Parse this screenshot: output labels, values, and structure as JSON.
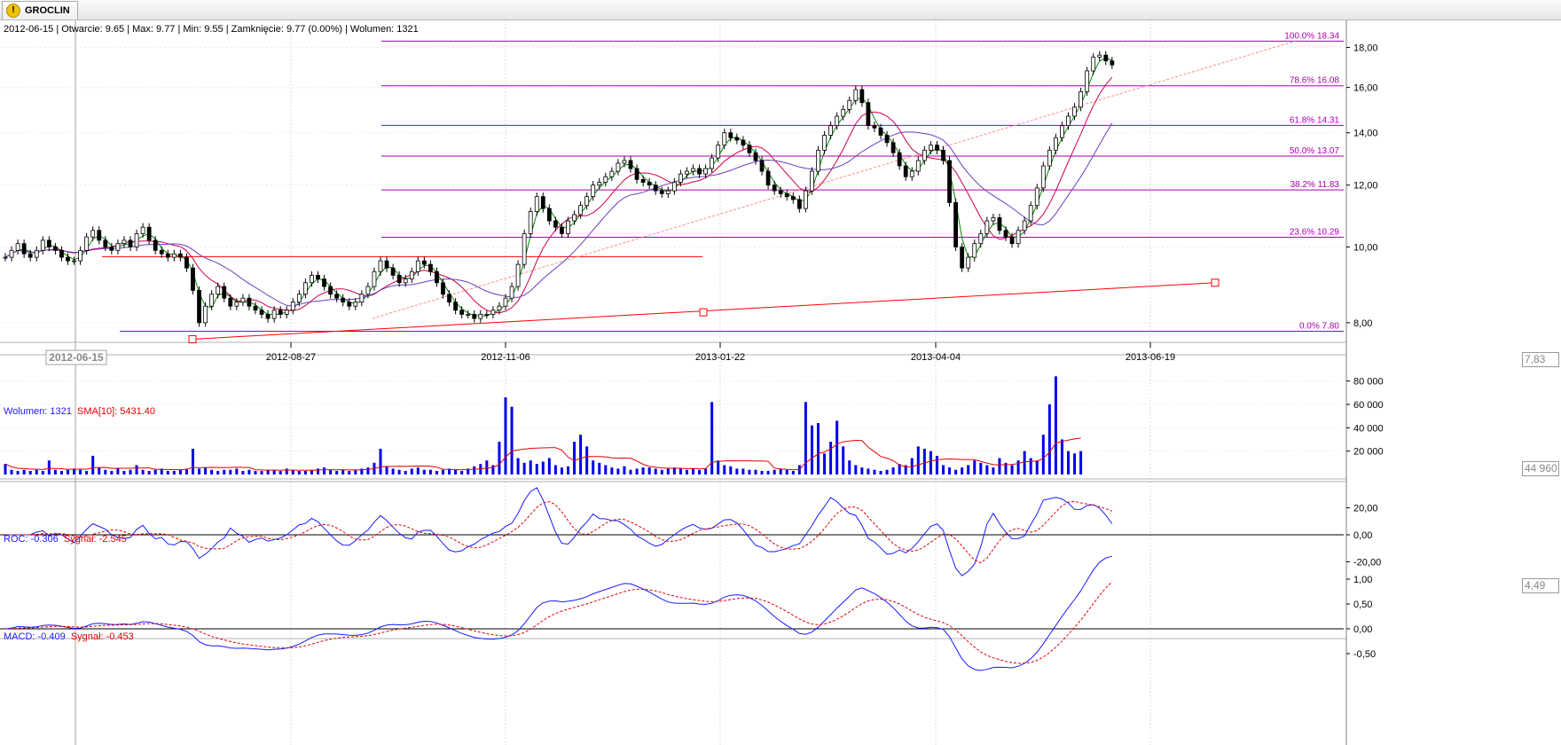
{
  "tab": {
    "title": "GROCLIN",
    "icon": "warning-icon"
  },
  "ohlc_header": "2012-06-15 | Otwarcie: 9.65 | Max: 9.77 | Min: 9.55 | Zamknięcie: 9.77 (0.00%) | Wolumen: 1321",
  "panes": {
    "volume": {
      "label": "Wolumen: 1321",
      "sma_label": "SMA[10]: 5431.40",
      "badge": "44 960"
    },
    "roc": {
      "label": "ROC: -0.306",
      "signal_label": "Sygnał: -2.545",
      "badge": "4,49"
    },
    "macd": {
      "label": "MACD: -0.409",
      "signal_label": "Sygnał: -0.453"
    }
  },
  "price_badge": "7,83",
  "cursor_date_label": "2012-06-15",
  "colors": {
    "fib": "#aa00aa",
    "trend": "#ff0000",
    "volume_bar": "#0000ee",
    "sma_fast": "#008800",
    "sma_mid": "#cc0044",
    "sma_slow": "#6a3dbf",
    "macd": "#1a1aff",
    "signal": "#e00000"
  },
  "chart_data": [
    {
      "type": "candlestick",
      "y_scale": "log",
      "x_tick_labels": [
        "2012-08-27",
        "2012-11-06",
        "2013-01-22",
        "2013-04-04",
        "2013-06-19"
      ],
      "y_tick_labels": [
        "8,00",
        "10,00",
        "12,00",
        "14,00",
        "16,00",
        "18,00"
      ],
      "fib_levels": [
        {
          "label": "0.0% 7.80",
          "value": 7.8
        },
        {
          "label": "23.6% 10.29",
          "value": 10.29
        },
        {
          "label": "38.2% 11.83",
          "value": 11.83
        },
        {
          "label": "50.0% 13.07",
          "value": 13.07
        },
        {
          "label": "61.8% 14.31",
          "value": 14.31
        },
        {
          "label": "78.6% 16.08",
          "value": 16.08
        },
        {
          "label": "100.0% 18.34",
          "value": 18.34
        }
      ],
      "close": [
        9.7,
        9.9,
        10.1,
        9.8,
        9.7,
        9.9,
        10.2,
        10.0,
        9.9,
        9.7,
        9.6,
        9.6,
        9.9,
        10.3,
        10.5,
        10.2,
        10.0,
        9.9,
        10.1,
        10.2,
        10.0,
        10.4,
        10.6,
        10.2,
        9.9,
        9.8,
        9.7,
        9.8,
        9.7,
        9.4,
        8.8,
        8.0,
        8.4,
        8.7,
        8.9,
        8.6,
        8.4,
        8.5,
        8.6,
        8.4,
        8.3,
        8.2,
        8.1,
        8.3,
        8.2,
        8.3,
        8.5,
        8.7,
        9.0,
        9.2,
        9.1,
        8.9,
        8.7,
        8.6,
        8.5,
        8.4,
        8.5,
        8.7,
        8.9,
        9.3,
        9.6,
        9.4,
        9.2,
        9.0,
        9.1,
        9.3,
        9.6,
        9.5,
        9.3,
        9.0,
        8.7,
        8.5,
        8.3,
        8.2,
        8.2,
        8.1,
        8.2,
        8.2,
        8.3,
        8.4,
        8.6,
        8.9,
        9.5,
        10.4,
        11.1,
        11.6,
        11.2,
        10.8,
        10.6,
        10.4,
        10.8,
        11.0,
        11.3,
        11.6,
        12.0,
        12.1,
        12.3,
        12.5,
        12.8,
        12.9,
        12.6,
        12.2,
        12.1,
        12.0,
        11.8,
        11.7,
        11.8,
        12.1,
        12.4,
        12.5,
        12.6,
        12.4,
        12.6,
        13.0,
        13.5,
        14.0,
        13.8,
        13.7,
        13.5,
        13.2,
        12.9,
        12.5,
        12.0,
        11.8,
        11.7,
        11.6,
        11.5,
        11.2,
        11.8,
        12.5,
        13.3,
        13.9,
        14.3,
        14.7,
        15.0,
        15.4,
        15.9,
        15.3,
        14.3,
        14.2,
        13.9,
        13.6,
        13.2,
        12.7,
        12.3,
        12.5,
        12.9,
        13.3,
        13.5,
        13.3,
        12.9,
        11.4,
        10.0,
        9.4,
        9.7,
        10.1,
        10.4,
        10.8,
        10.9,
        10.5,
        10.3,
        10.1,
        10.5,
        10.8,
        11.3,
        11.9,
        12.7,
        13.3,
        13.8,
        14.3,
        14.7,
        15.1,
        15.8,
        16.8,
        17.5,
        17.6,
        17.3,
        17.1
      ]
    },
    {
      "type": "bar",
      "name": "Wolumen",
      "y_tick_labels": [
        "20 000",
        "40 000",
        "60 000",
        "80 000"
      ],
      "values": [
        9,
        4,
        3,
        4,
        3,
        4,
        3,
        12,
        4,
        3,
        4,
        5,
        4,
        3,
        16,
        6,
        4,
        3,
        5,
        3,
        4,
        8,
        4,
        3,
        4,
        5,
        3,
        3,
        4,
        5,
        22,
        5,
        6,
        4,
        3,
        4,
        4,
        5,
        3,
        4,
        3,
        3,
        4,
        4,
        3,
        5,
        4,
        3,
        3,
        4,
        5,
        6,
        4,
        3,
        4,
        3,
        4,
        5,
        6,
        10,
        22,
        7,
        5,
        4,
        3,
        5,
        6,
        4,
        4,
        3,
        4,
        5,
        4,
        3,
        5,
        7,
        9,
        12,
        8,
        28,
        66,
        58,
        14,
        10,
        12,
        9,
        11,
        14,
        8,
        6,
        7,
        28,
        34,
        24,
        12,
        10,
        8,
        6,
        5,
        7,
        4,
        5,
        6,
        6,
        5,
        4,
        5,
        6,
        5,
        4,
        5,
        4,
        5,
        62,
        12,
        8,
        7,
        5,
        5,
        4,
        4,
        3,
        3,
        4,
        5,
        4,
        3,
        8,
        62,
        42,
        44,
        18,
        28,
        46,
        24,
        12,
        8,
        6,
        5,
        4,
        3,
        4,
        6,
        9,
        8,
        14,
        24,
        22,
        20,
        16,
        8,
        6,
        4,
        6,
        8,
        12,
        10,
        8,
        6,
        14,
        10,
        8,
        12,
        20,
        14,
        12,
        34,
        60,
        84,
        30,
        20,
        18,
        20
      ]
    },
    {
      "type": "line",
      "name": "ROC",
      "y_tick_labels": [
        "-20,00",
        "0,00",
        "20,00"
      ]
    },
    {
      "type": "line",
      "name": "MACD",
      "y_tick_labels": [
        "-0,50",
        "0,00",
        "0,50",
        "1,00"
      ]
    }
  ]
}
